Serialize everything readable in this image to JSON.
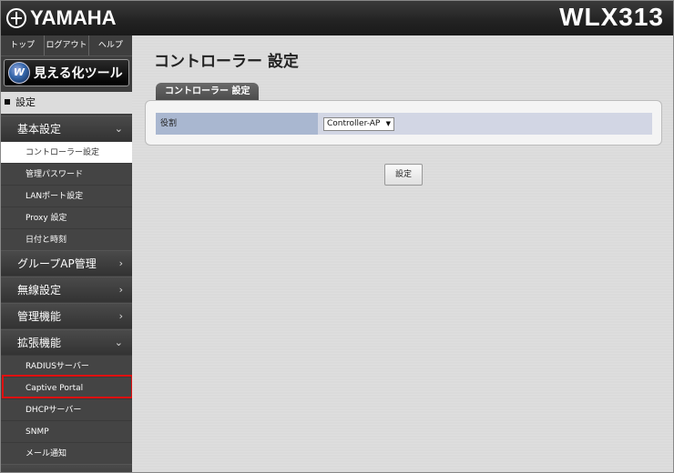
{
  "header": {
    "brand": "YAMAHA",
    "model": "WLX313"
  },
  "sidebar": {
    "topnav": [
      "トップ",
      "ログアウト",
      "ヘルプ"
    ],
    "viz_button": "見える化ツール",
    "section": "設定",
    "categories": [
      {
        "label": "基本設定",
        "expanded": true,
        "items": [
          "コントローラー設定",
          "管理パスワード",
          "LANポート設定",
          "Proxy 設定",
          "日付と時刻"
        ]
      },
      {
        "label": "グループAP管理",
        "expanded": false
      },
      {
        "label": "無線設定",
        "expanded": false
      },
      {
        "label": "管理機能",
        "expanded": false
      },
      {
        "label": "拡張機能",
        "expanded": true,
        "items": [
          "RADIUSサーバー",
          "Captive Portal",
          "DHCPサーバー",
          "SNMP",
          "メール通知"
        ]
      }
    ]
  },
  "main": {
    "title": "コントローラー 設定",
    "tab": "コントローラー 設定",
    "form": {
      "role_label": "役割",
      "role_value": "Controller-AP"
    },
    "submit_label": "設定"
  },
  "colors": {
    "highlight": "#e01010",
    "label_cell": "#a9b7d0",
    "value_cell": "#d2d6e4"
  }
}
